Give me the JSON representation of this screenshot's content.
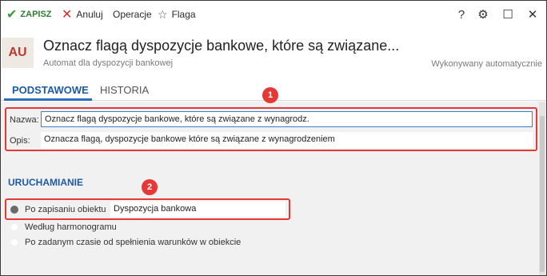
{
  "toolbar": {
    "save_label": "ZAPISZ",
    "cancel_label": "Anuluj",
    "operations_label": "Operacje",
    "flag_label": "Flaga",
    "help_glyph": "?",
    "settings_glyph": "⚙",
    "maximize_glyph": "☐",
    "close_glyph": "✕",
    "save_icon": "check-icon",
    "cancel_icon": "x-icon",
    "flag_icon": "star-icon"
  },
  "header": {
    "avatar_text": "AU",
    "title": "Oznacz flagą dyspozycje bankowe, które są związane...",
    "subtitle": "Automat dla dyspozycji bankowej",
    "status": "Wykonywany automatycznie"
  },
  "tabs": [
    {
      "label": "PODSTAWOWE",
      "active": true
    },
    {
      "label": "HISTORIA",
      "active": false
    }
  ],
  "form": {
    "badge1": "1",
    "badge2": "2",
    "name_label": "Nazwa:",
    "name_value": "Oznacz flagą dyspozycje bankowe, które są związane z wynagrodz.",
    "description_label": "Opis:",
    "description_value": "Oznacza flagą, dyspozycje bankowe które są związane z wynagrodzeniem"
  },
  "trigger": {
    "section_title": "URUCHAMIANIE",
    "options": [
      {
        "label": "Po zapisaniu obiektu",
        "checked": true,
        "value": "Dyspozycja bankowa"
      },
      {
        "label": "Według harmonogramu",
        "checked": false
      },
      {
        "label": "Po zadanym czasie od spełnienia warunków w obiekcie",
        "checked": false
      }
    ]
  },
  "colors": {
    "accent": "#1f5aa6",
    "save_green": "#2e7d32",
    "cancel_red": "#d32f2f",
    "highlight_red": "#e53935",
    "avatar_text": "#c0392b"
  }
}
